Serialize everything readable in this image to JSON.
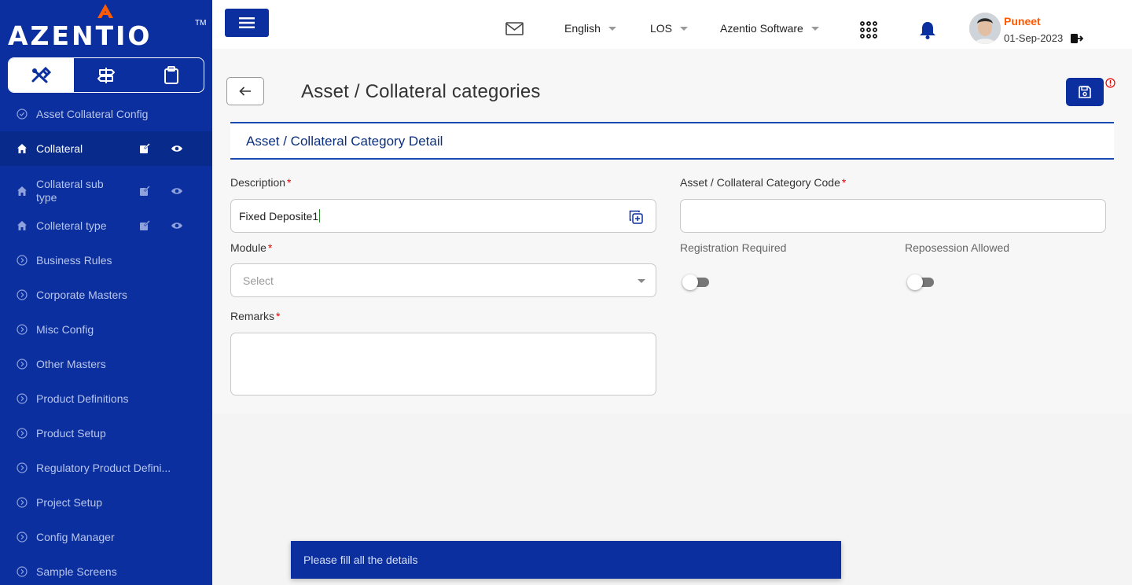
{
  "brand": {
    "name": "AZENTIO",
    "tm": "TM"
  },
  "sidebar": {
    "tabs": [
      "tools-icon",
      "signpost-icon",
      "clipboard-icon"
    ],
    "items": [
      {
        "label": "Asset Collateral Config",
        "icon": "circle-check-icon",
        "active": false
      },
      {
        "label": "Collateral",
        "icon": "home-icon",
        "active": true
      },
      {
        "label": "Collateral sub type",
        "icon": "home-icon",
        "active": false
      },
      {
        "label": "Colleteral type",
        "icon": "home-icon",
        "active": false
      },
      {
        "label": "Business Rules",
        "icon": "chevron-circle-icon",
        "active": false
      },
      {
        "label": "Corporate Masters",
        "icon": "chevron-circle-icon",
        "active": false
      },
      {
        "label": "Misc Config",
        "icon": "chevron-circle-icon",
        "active": false
      },
      {
        "label": "Other Masters",
        "icon": "chevron-circle-icon",
        "active": false
      },
      {
        "label": "Product Definitions",
        "icon": "chevron-circle-icon",
        "active": false
      },
      {
        "label": "Product Setup",
        "icon": "chevron-circle-icon",
        "active": false
      },
      {
        "label": "Regulatory Product Defini...",
        "icon": "chevron-circle-icon",
        "active": false
      },
      {
        "label": "Project Setup",
        "icon": "chevron-circle-icon",
        "active": false
      },
      {
        "label": "Config Manager",
        "icon": "chevron-circle-icon",
        "active": false
      },
      {
        "label": "Sample Screens",
        "icon": "chevron-circle-icon",
        "active": false
      }
    ]
  },
  "topbar": {
    "language": "English",
    "module": "LOS",
    "company": "Azentio Software",
    "user": {
      "name": "Puneet",
      "date": "01-Sep-2023"
    }
  },
  "page": {
    "title": "Asset / Collateral categories",
    "section_title": "Asset / Collateral Category Detail"
  },
  "form": {
    "description": {
      "label": "Description",
      "value": "Fixed Deposite1"
    },
    "category_code": {
      "label": "Asset / Collateral Category Code",
      "value": ""
    },
    "module": {
      "label": "Module",
      "placeholder": "Select"
    },
    "registration_required": {
      "label": "Registration Required",
      "on": false
    },
    "reposession_allowed": {
      "label": "Reposession Allowed",
      "on": false
    },
    "remarks": {
      "label": "Remarks",
      "value": ""
    },
    "required_mark": "*"
  },
  "toast": {
    "message": "Please fill all the details"
  },
  "colors": {
    "primary": "#0b2f9e",
    "accent": "#ff5a00",
    "required": "#e00000"
  }
}
